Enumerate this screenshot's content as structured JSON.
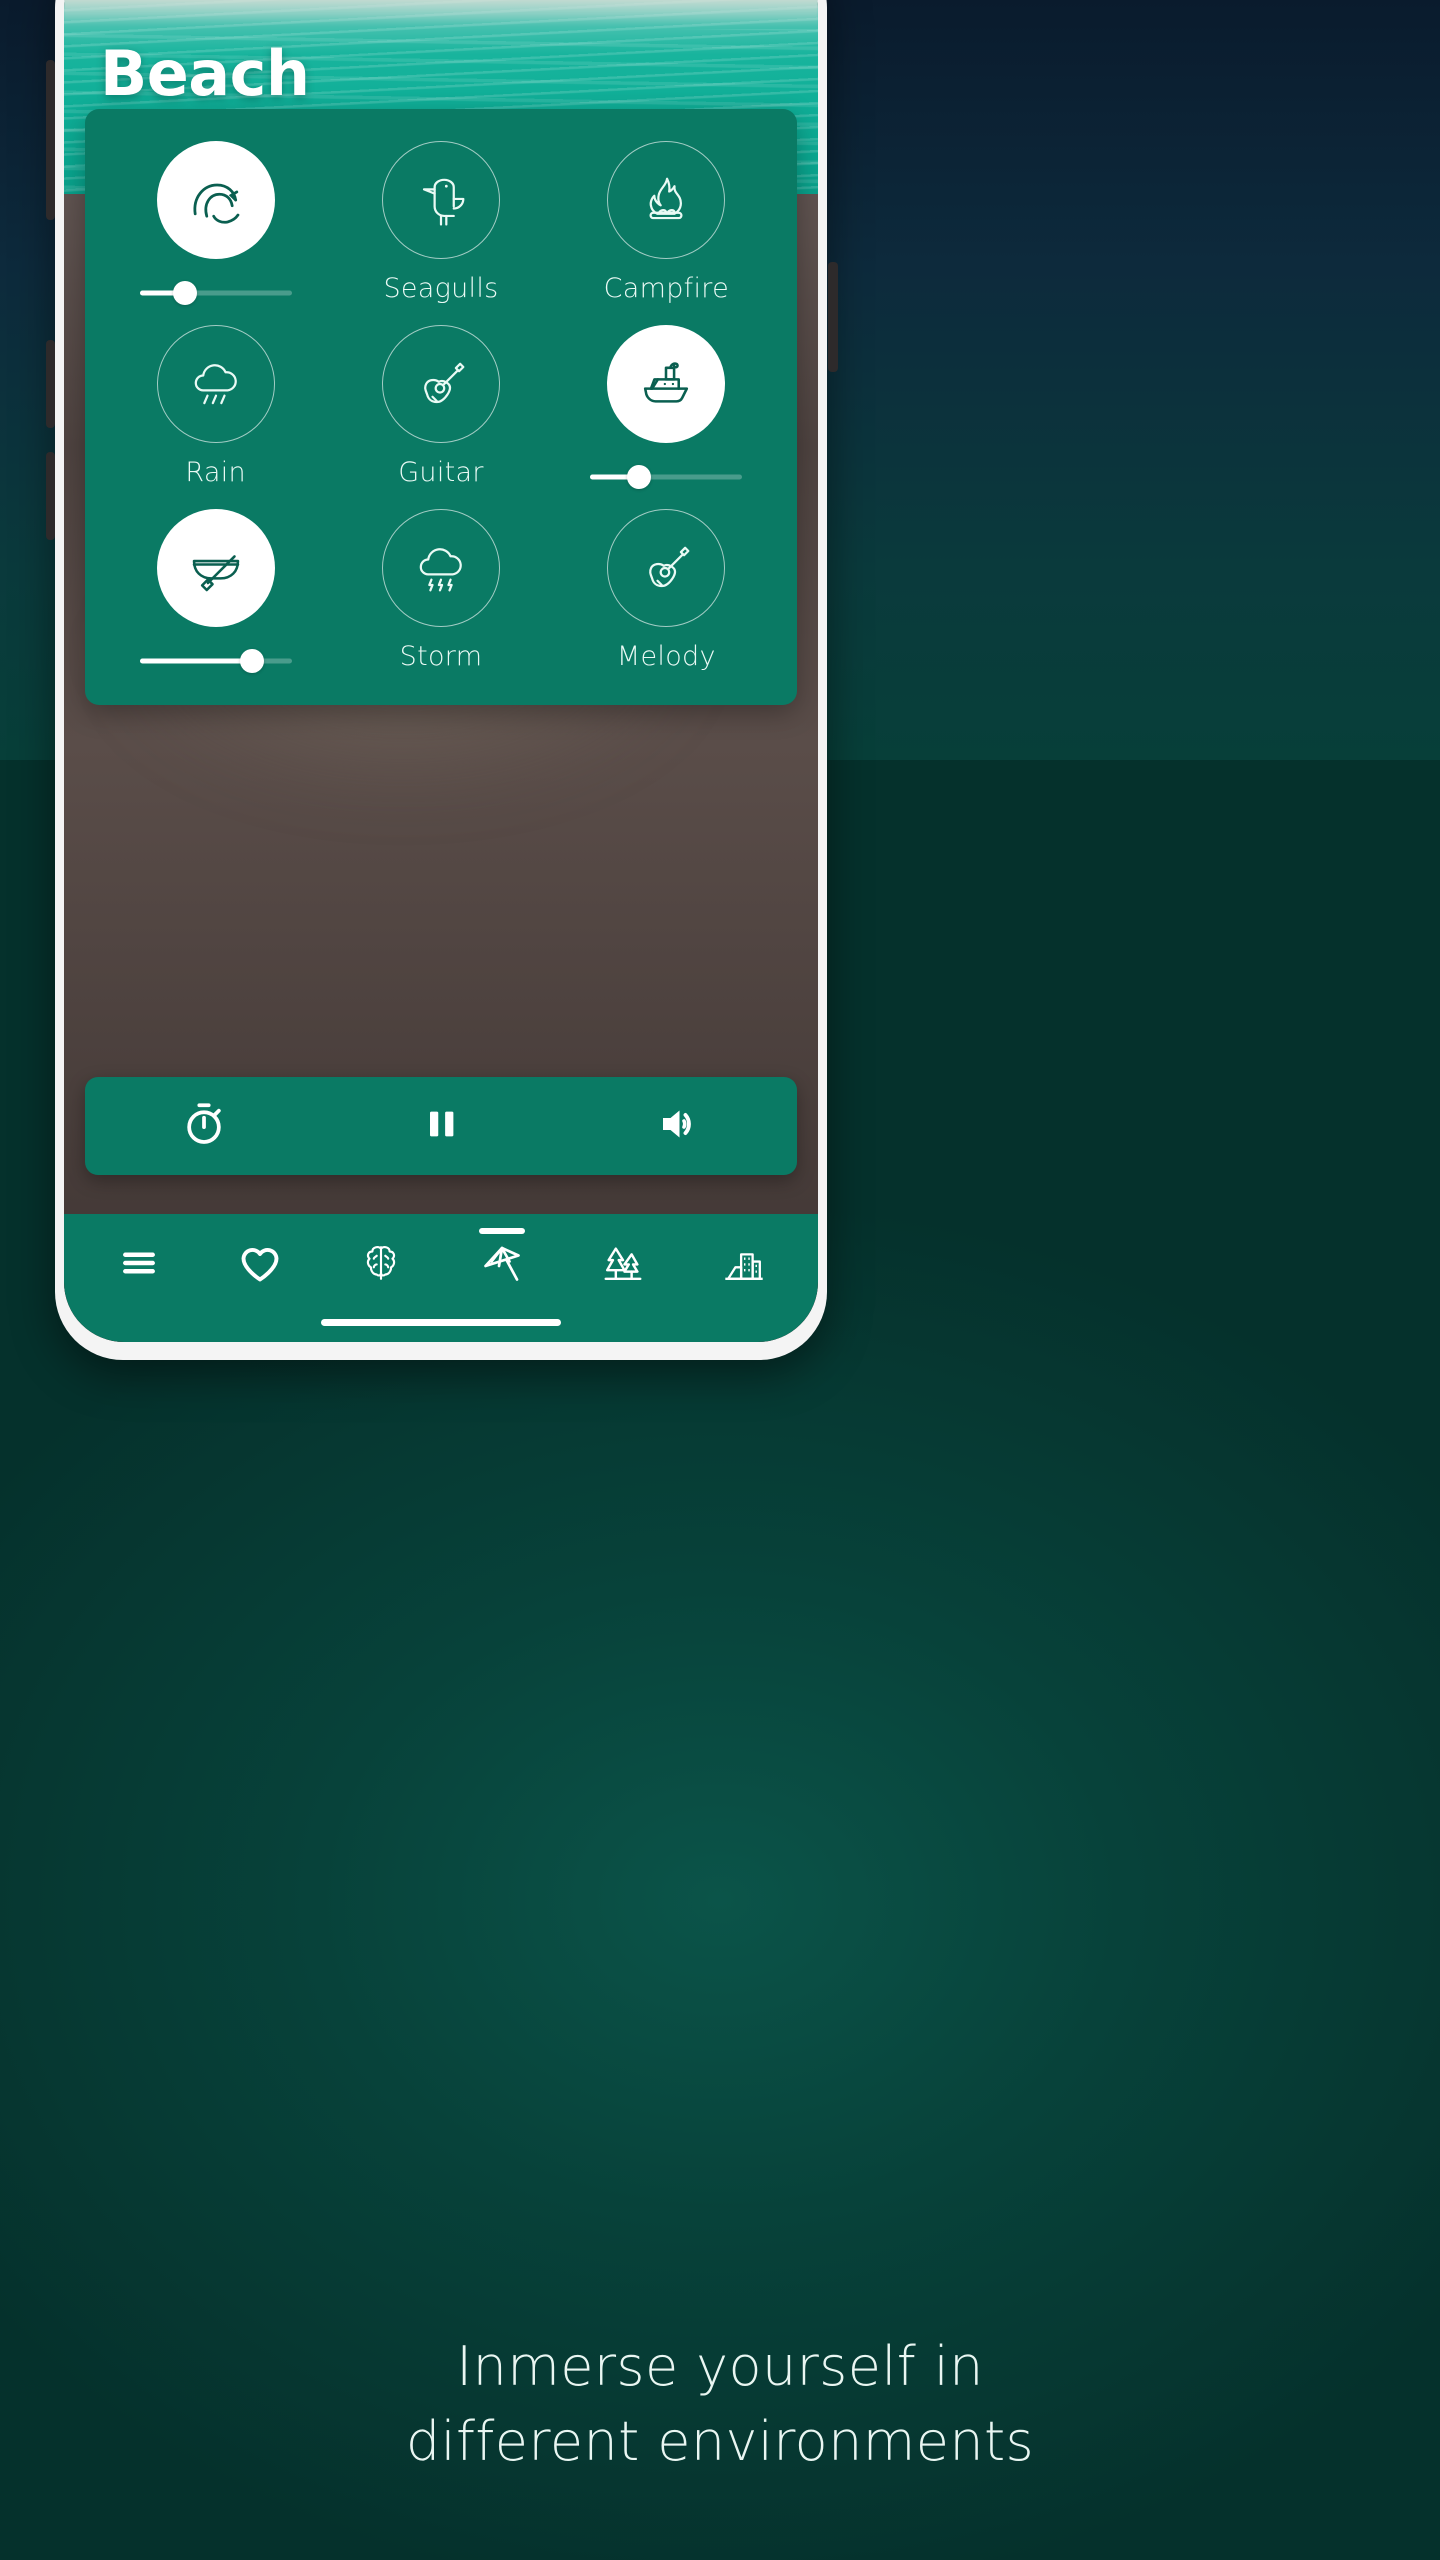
{
  "screen": {
    "title": "Beach",
    "theme_color": "#0a7a64",
    "accent_color": "#ffffff"
  },
  "sounds": [
    {
      "id": "waves",
      "label": "",
      "icon": "wave-icon",
      "active": true,
      "volume": 30
    },
    {
      "id": "seagulls",
      "label": "Seagulls",
      "icon": "seagull-icon",
      "active": false,
      "volume": 0
    },
    {
      "id": "campfire",
      "label": "Campfire",
      "icon": "campfire-icon",
      "active": false,
      "volume": 0
    },
    {
      "id": "rain",
      "label": "Rain",
      "icon": "rain-cloud-icon",
      "active": false,
      "volume": 0
    },
    {
      "id": "guitar",
      "label": "Guitar",
      "icon": "guitar-icon",
      "active": false,
      "volume": 0
    },
    {
      "id": "ship",
      "label": "",
      "icon": "ship-icon",
      "active": true,
      "volume": 32
    },
    {
      "id": "canoe",
      "label": "",
      "icon": "canoe-icon",
      "active": true,
      "volume": 74
    },
    {
      "id": "storm",
      "label": "Storm",
      "icon": "storm-cloud-icon",
      "active": false,
      "volume": 0
    },
    {
      "id": "melody",
      "label": "Melody",
      "icon": "guitar-icon",
      "active": false,
      "volume": 0
    }
  ],
  "playback": {
    "timer_icon": "stopwatch-icon",
    "play_pause_icon": "pause-icon",
    "volume_icon": "volume-up-icon"
  },
  "navigation": {
    "items": [
      {
        "id": "menu",
        "icon": "hamburger-menu-icon",
        "active": false
      },
      {
        "id": "favorites",
        "icon": "heart-icon",
        "active": false
      },
      {
        "id": "mind",
        "icon": "brain-icon",
        "active": false
      },
      {
        "id": "beach",
        "icon": "beach-umbrella-icon",
        "active": true
      },
      {
        "id": "forest",
        "icon": "pine-trees-icon",
        "active": false
      },
      {
        "id": "city",
        "icon": "city-buildings-icon",
        "active": false
      }
    ]
  },
  "caption": {
    "line1": "Inmerse yourself in",
    "line2": "different environments"
  }
}
